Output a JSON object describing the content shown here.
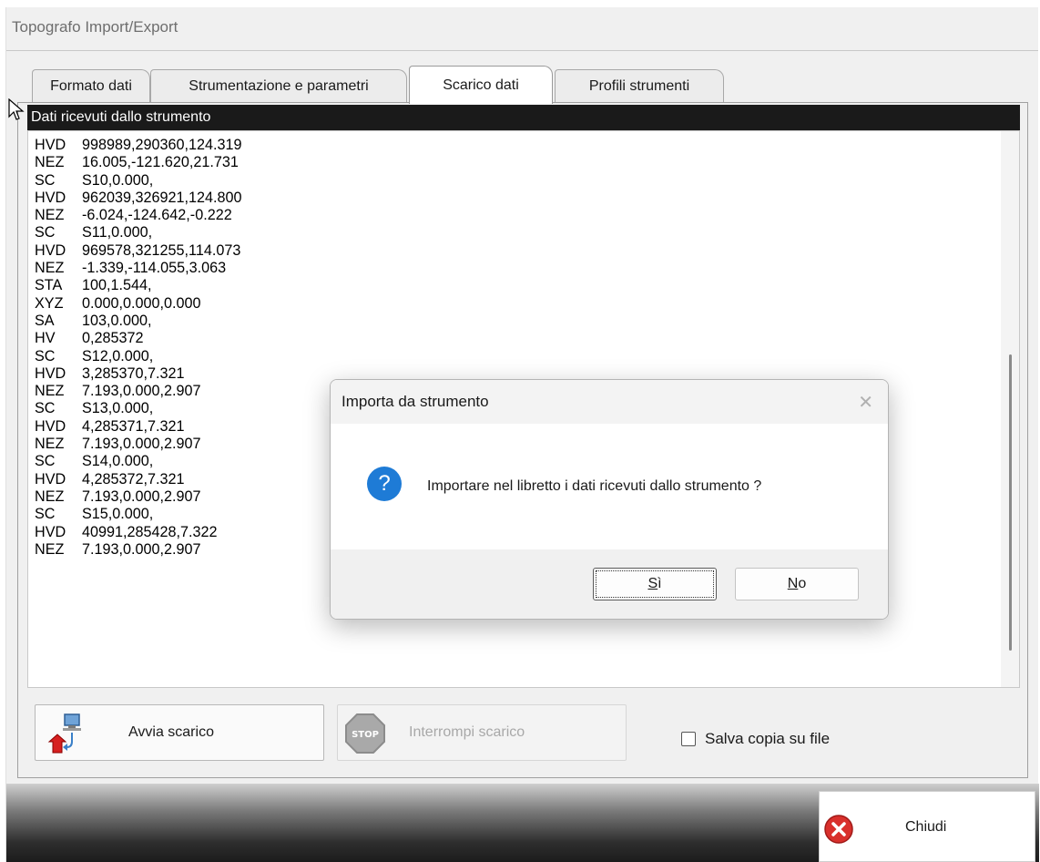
{
  "window": {
    "title": "Topografo Import/Export"
  },
  "tabs": [
    {
      "label": "Formato dati"
    },
    {
      "label": "Strumentazione e parametri"
    },
    {
      "label": "Scarico dati"
    },
    {
      "label": "Profili strumenti"
    }
  ],
  "list": {
    "header": "Dati ricevuti dallo strumento",
    "lines": [
      {
        "code": "HVD",
        "value": "998989,290360,124.319"
      },
      {
        "code": "NEZ",
        "value": "16.005,-121.620,21.731"
      },
      {
        "code": "SC",
        "value": "S10,0.000,"
      },
      {
        "code": "HVD",
        "value": "962039,326921,124.800"
      },
      {
        "code": "NEZ",
        "value": "-6.024,-124.642,-0.222"
      },
      {
        "code": "SC",
        "value": "S11,0.000,"
      },
      {
        "code": "HVD",
        "value": "969578,321255,114.073"
      },
      {
        "code": "NEZ",
        "value": "-1.339,-114.055,3.063"
      },
      {
        "code": "STA",
        "value": "100,1.544,"
      },
      {
        "code": "XYZ",
        "value": "0.000,0.000,0.000"
      },
      {
        "code": "SA",
        "value": "103,0.000,"
      },
      {
        "code": "HV",
        "value": "0,285372"
      },
      {
        "code": "SC",
        "value": "S12,0.000,"
      },
      {
        "code": "HVD",
        "value": "3,285370,7.321"
      },
      {
        "code": "NEZ",
        "value": "7.193,0.000,2.907"
      },
      {
        "code": "SC",
        "value": "S13,0.000,"
      },
      {
        "code": "HVD",
        "value": "4,285371,7.321"
      },
      {
        "code": "NEZ",
        "value": "7.193,0.000,2.907"
      },
      {
        "code": "SC",
        "value": "S14,0.000,"
      },
      {
        "code": "HVD",
        "value": "4,285372,7.321"
      },
      {
        "code": "NEZ",
        "value": "7.193,0.000,2.907"
      },
      {
        "code": "SC",
        "value": "S15,0.000,"
      },
      {
        "code": "HVD",
        "value": "40991,285428,7.322"
      },
      {
        "code": "NEZ",
        "value": "7.193,0.000,2.907"
      }
    ]
  },
  "actions": {
    "start_label": "Avvia scarico",
    "stop_label": "Interrompi scarico",
    "save_copy_label": "Salva copia su file",
    "close_label": "Chiudi"
  },
  "dialog": {
    "title": "Importa da strumento",
    "close_glyph": "✕",
    "icon_glyph": "?",
    "message": "Importare nel libretto i dati ricevuti dallo strumento ?",
    "yes_mnemonic": "S",
    "yes_rest": "ì",
    "no_mnemonic": "N",
    "no_rest": "o"
  },
  "colors": {
    "list_header_bg": "#1a1a1a",
    "question_icon": "#1e7bd6",
    "close_icon_red": "#d9302c"
  }
}
